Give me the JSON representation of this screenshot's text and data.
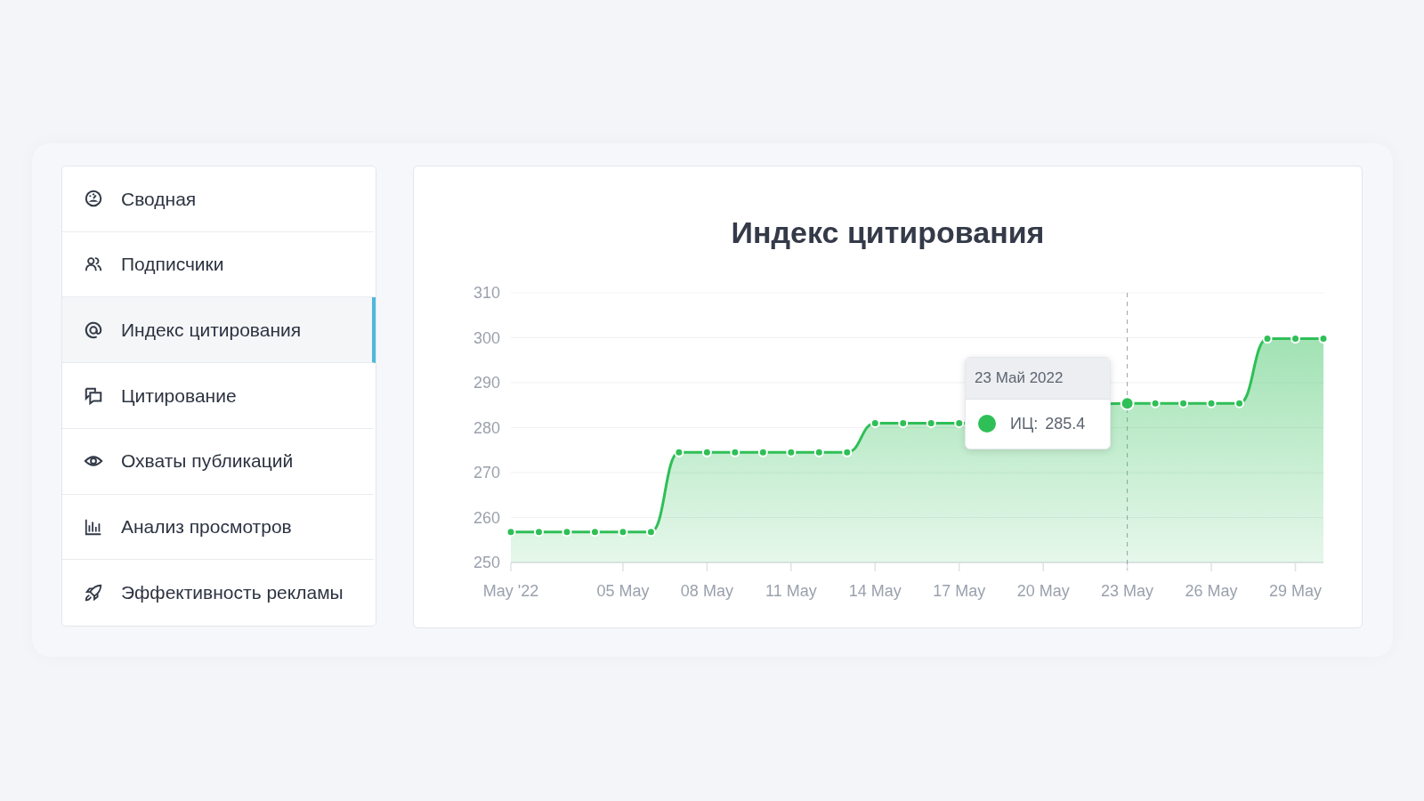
{
  "sidebar": {
    "items": [
      {
        "kind": "dashboard",
        "label": "Сводная",
        "selected": false
      },
      {
        "kind": "users",
        "label": "Подписчики",
        "selected": false
      },
      {
        "kind": "at",
        "label": "Индекс цитирования",
        "selected": true
      },
      {
        "kind": "quote",
        "label": "Цитирование",
        "selected": false
      },
      {
        "kind": "eye",
        "label": "Охваты публикаций",
        "selected": false
      },
      {
        "kind": "bars",
        "label": "Анализ просмотров",
        "selected": false
      },
      {
        "kind": "rocket",
        "label": "Эффективность рекламы",
        "selected": false
      }
    ]
  },
  "chart_panel": {
    "title": "Индекс цитирования",
    "chart_data": {
      "type": "area",
      "categories": [
        "May '22",
        null,
        null,
        null,
        "05 May",
        null,
        null,
        "08 May",
        null,
        null,
        "11 May",
        null,
        null,
        "14 May",
        null,
        null,
        "17 May",
        null,
        null,
        "20 May",
        null,
        null,
        "23 May",
        null,
        null,
        "26 May",
        null,
        null,
        "29 May",
        null
      ],
      "series": [
        {
          "color": "#2fbf57",
          "values": [
            256.8,
            256.8,
            256.8,
            256.8,
            256.8,
            256.8,
            274.5,
            274.5,
            274.5,
            274.5,
            274.5,
            274.5,
            274.5,
            281,
            281,
            281,
            281,
            null,
            null,
            null,
            null,
            null,
            285.4,
            285.4,
            285.4,
            285.4,
            285.4,
            299.8,
            299.8,
            299.8
          ]
        }
      ],
      "ylim": [
        250,
        310
      ],
      "yticks": [
        250,
        260,
        270,
        280,
        290,
        300,
        310
      ],
      "grid": true,
      "ref_lines": [
        {
          "axis": "x",
          "value": "23 May"
        }
      ]
    },
    "tooltip": {
      "date": "23 Май 2022",
      "label": "ИЦ:",
      "value": "285.4",
      "color": "#2fbf57"
    }
  }
}
